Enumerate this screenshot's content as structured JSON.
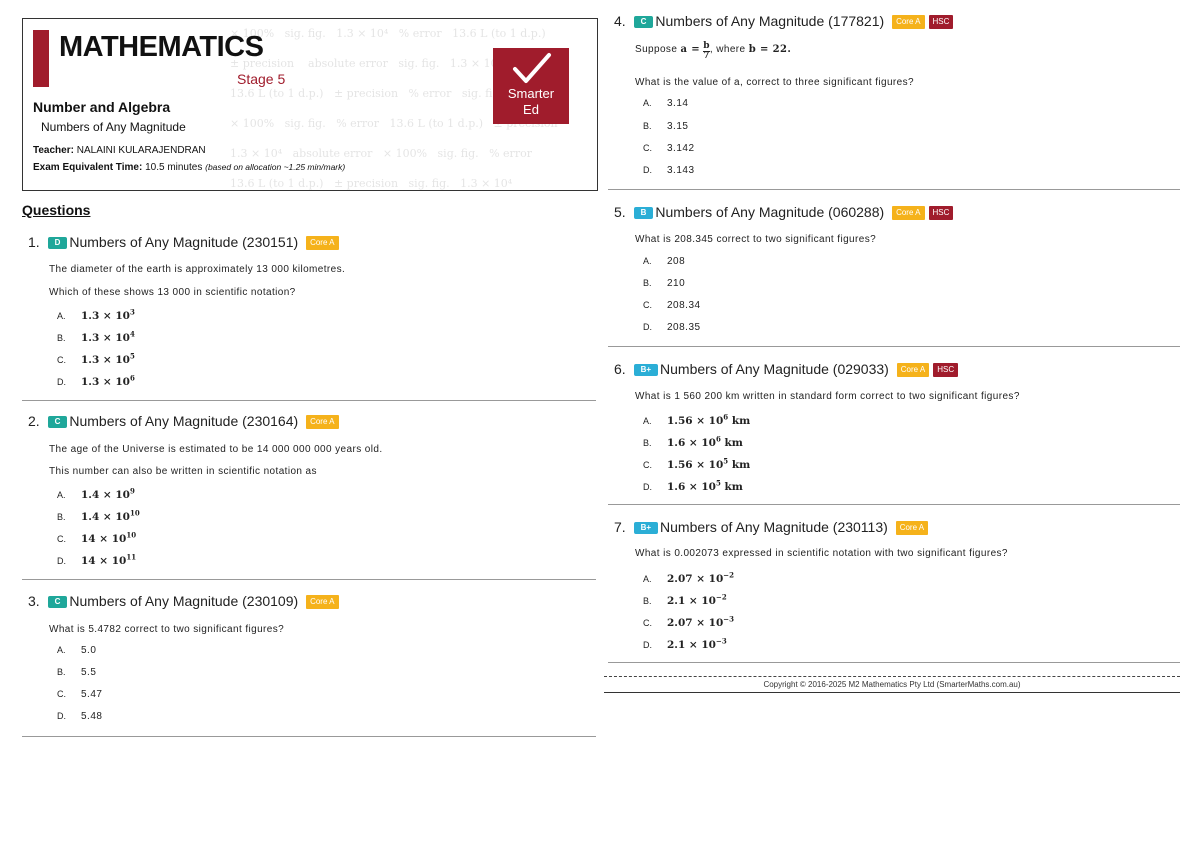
{
  "header": {
    "title": "MATHEMATICS",
    "stage": "Stage 5",
    "strand": "Number and Algebra",
    "topic": "Numbers of Any Magnitude",
    "teacher_label": "Teacher:",
    "teacher_name": "NALAINI KULARAJENDRAN",
    "exam_label": "Exam Equivalent Time:",
    "exam_time": "10.5 minutes",
    "exam_note": "(based on allocation ~1.25 min/mark)",
    "logo_line1": "Smarter",
    "logo_line2": "Ed",
    "brand_color": "#a01c2c"
  },
  "questions_heading": "Questions",
  "questions": [
    {
      "num": "1.",
      "grade": "D",
      "title": "Numbers of Any Magnitude (230151)",
      "tags": [
        "Core A"
      ],
      "text": [
        "The diameter of the earth is approximately 13 000 kilometres.",
        "Which of these shows 13 000 in scientific notation?"
      ],
      "options": [
        {
          "letter": "A.",
          "base": "1.3 × 10",
          "exp": "3"
        },
        {
          "letter": "B.",
          "base": "1.3 × 10",
          "exp": "4"
        },
        {
          "letter": "C.",
          "base": "1.3 × 10",
          "exp": "5"
        },
        {
          "letter": "D.",
          "base": "1.3 × 10",
          "exp": "6"
        }
      ]
    },
    {
      "num": "2.",
      "grade": "C",
      "title": "Numbers of Any Magnitude (230164)",
      "tags": [
        "Core A"
      ],
      "text": [
        "The age of the Universe is estimated to be  14 000 000 000  years old.",
        "This number can also be written in scientific notation as"
      ],
      "options": [
        {
          "letter": "A.",
          "base": "1.4 × 10",
          "exp": "9"
        },
        {
          "letter": "B.",
          "base": "1.4 × 10",
          "exp": "10"
        },
        {
          "letter": "C.",
          "base": "14 × 10",
          "exp": "10"
        },
        {
          "letter": "D.",
          "base": "14 × 10",
          "exp": "11"
        }
      ]
    },
    {
      "num": "3.",
      "grade": "C",
      "title": "Numbers of Any Magnitude (230109)",
      "tags": [
        "Core A"
      ],
      "text": [
        "What is  5.4782  correct to two significant figures?"
      ],
      "options": [
        {
          "letter": "A.",
          "value": "5.0"
        },
        {
          "letter": "B.",
          "value": "5.5"
        },
        {
          "letter": "C.",
          "value": "5.47"
        },
        {
          "letter": "D.",
          "value": "5.48"
        }
      ]
    },
    {
      "num": "4.",
      "grade": "C",
      "title": "Numbers of Any Magnitude (177821)",
      "tags": [
        "Core A",
        "HSC"
      ],
      "text_parts": {
        "suppose": "Suppose",
        "a_eq": "a =",
        "frac_n": "b",
        "frac_d": "7",
        "where": ", where",
        "b_eq": "b = 22."
      },
      "text": [
        "What is the value of  a, correct to three significant figures?"
      ],
      "options": [
        {
          "letter": "A.",
          "value": "3.14"
        },
        {
          "letter": "B.",
          "value": "3.15"
        },
        {
          "letter": "C.",
          "value": "3.142"
        },
        {
          "letter": "D.",
          "value": "3.143"
        }
      ]
    },
    {
      "num": "5.",
      "grade": "B",
      "title": "Numbers of Any Magnitude (060288)",
      "tags": [
        "Core A",
        "HSC"
      ],
      "text": [
        "What is  208.345  correct to two significant figures?"
      ],
      "options": [
        {
          "letter": "A.",
          "value": "208"
        },
        {
          "letter": "B.",
          "value": "210"
        },
        {
          "letter": "C.",
          "value": "208.34"
        },
        {
          "letter": "D.",
          "value": "208.35"
        }
      ]
    },
    {
      "num": "6.",
      "grade": "B+",
      "title": "Numbers of Any Magnitude (029033)",
      "tags": [
        "Core A",
        "HSC"
      ],
      "text": [
        "What is  1 560 200 km written in standard form correct to two significant figures?"
      ],
      "options": [
        {
          "letter": "A.",
          "base": "1.56 × 10",
          "exp": "6",
          "unit": " km"
        },
        {
          "letter": "B.",
          "base": "1.6 × 10",
          "exp": "6",
          "unit": " km"
        },
        {
          "letter": "C.",
          "base": "1.56 × 10",
          "exp": "5",
          "unit": " km"
        },
        {
          "letter": "D.",
          "base": "1.6 × 10",
          "exp": "5",
          "unit": " km"
        }
      ]
    },
    {
      "num": "7.",
      "grade": "B+",
      "title": "Numbers of Any Magnitude (230113)",
      "tags": [
        "Core A"
      ],
      "text": [
        "What is 0.002073 expressed in scientific notation with two significant figures?"
      ],
      "options": [
        {
          "letter": "A.",
          "base": "2.07 × 10",
          "exp": "−2"
        },
        {
          "letter": "B.",
          "base": "2.1 × 10",
          "exp": "−2"
        },
        {
          "letter": "C.",
          "base": "2.07 × 10",
          "exp": "−3"
        },
        {
          "letter": "D.",
          "base": "2.1 × 10",
          "exp": "−3"
        }
      ]
    }
  ],
  "footer": "Copyright © 2016-2025 M2 Mathematics Pty Ltd (SmarterMaths.com.au)"
}
